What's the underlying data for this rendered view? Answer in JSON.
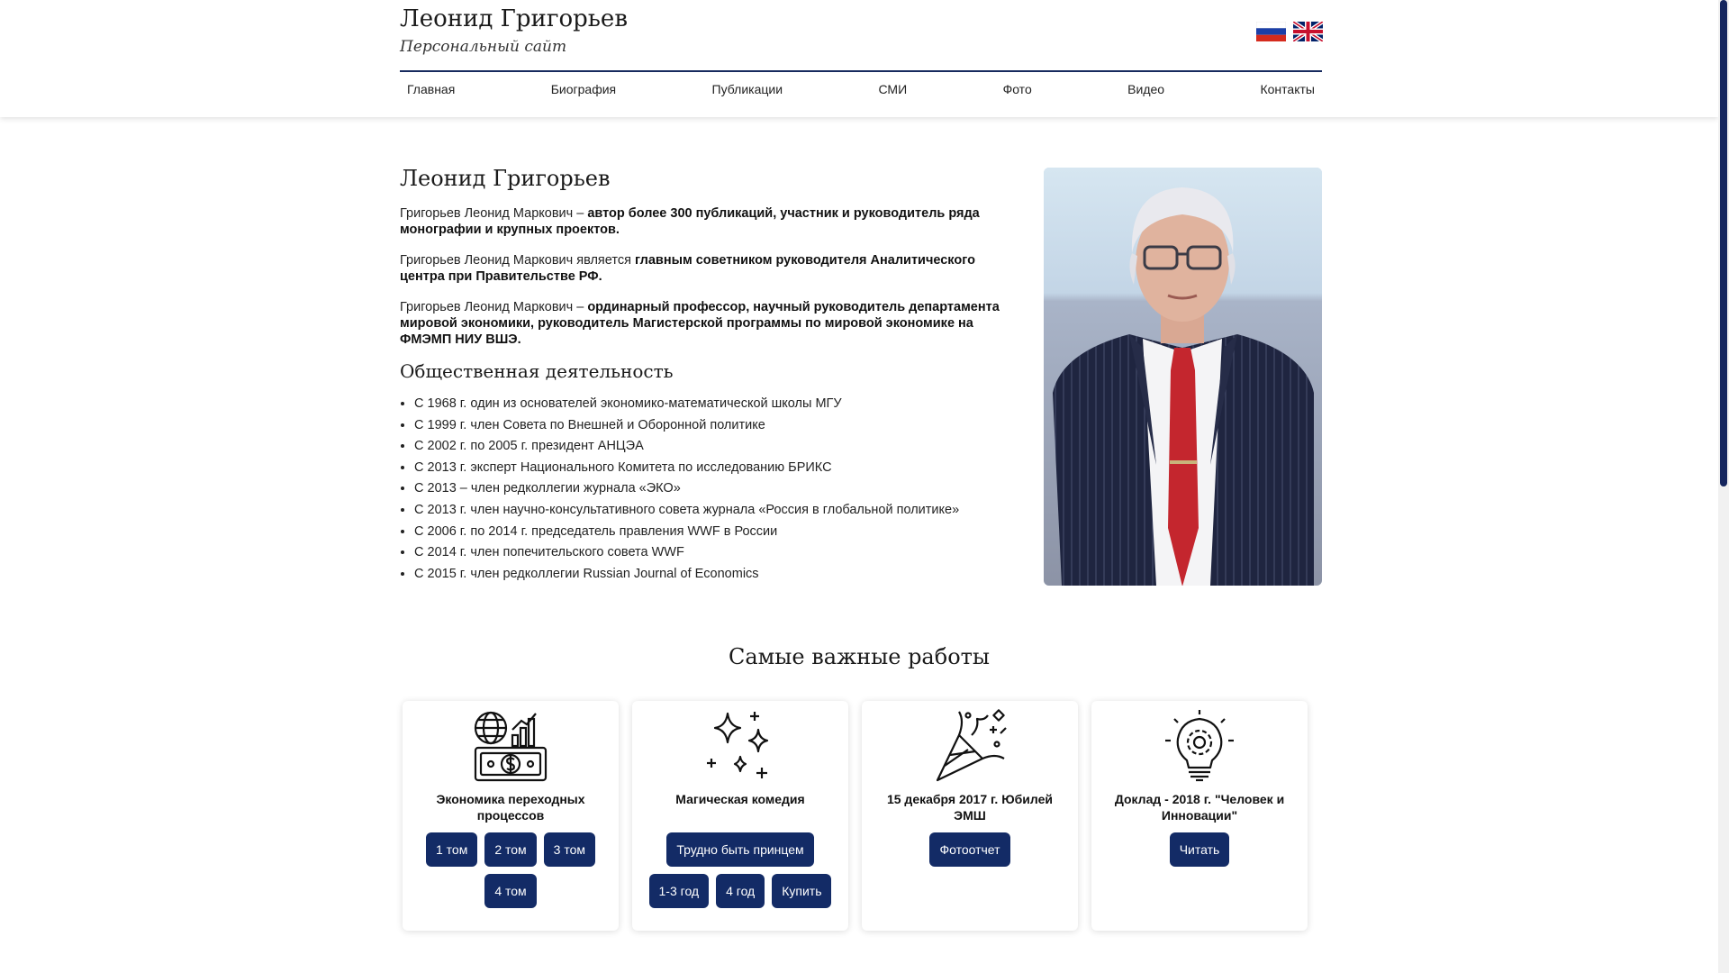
{
  "header": {
    "site_name": "Леонид Григорьев",
    "site_subtitle": "Персональный сайт",
    "nav": [
      "Главная",
      "Биография",
      "Публикации",
      "СМИ",
      "Фото",
      "Видео",
      "Контакты"
    ]
  },
  "main": {
    "title": "Леонид Григорьев",
    "bio": [
      {
        "plain": "Григорьев Леонид Маркович – ",
        "bold": "автор более 300 публикаций, участник и руководитель ряда монографии и крупных проектов."
      },
      {
        "plain": "Григорьев Леонид Маркович является ",
        "bold": "главным советником руководителя Аналитического центра при Правительстве РФ."
      },
      {
        "plain": "Григорьев Леонид Маркович – ",
        "bold": "ординарный профессор, научный руководитель департамента мировой экономики, руководитель Магистерской программы по мировой экономике на ФМЭМП НИУ ВШЭ."
      }
    ],
    "activity_title": "Общественная деятельность",
    "activity": [
      "С 1968 г. один из основателей экономико-математической школы МГУ",
      "С 1999 г. член Совета по Внешней и Оборонной политике",
      "С 2002 г. по 2005 г. президент АНЦЭА",
      "С 2013 г. эксперт Национального Комитета по исследованию БРИКС",
      "С 2013 – член редколлегии журнала «ЭКО»",
      "С 2013 г. член научно-консультативного совета журнала «Россия в глобальной политике»",
      "С 2006 г. по 2014 г. председатель правления WWF в России",
      "С 2014 г. член попечительского совета WWF",
      "С 2015 г. член редколлегии Russian Journal of Economics"
    ]
  },
  "works": {
    "title": "Самые важные работы",
    "cards": [
      {
        "icon": "globe-money-icon",
        "title": "Экономика переходных процессов",
        "buttons": [
          "1 том",
          "2 том",
          "3 том",
          "4 том"
        ]
      },
      {
        "icon": "sparkles-icon",
        "title": "Магическая комедия",
        "buttons": [
          "Трудно быть принцем",
          "1-3 год",
          "4 год",
          "Купить"
        ]
      },
      {
        "icon": "party-popper-icon",
        "title": "15 декабря 2017 г. Юбилей ЭМШ",
        "buttons": [
          "Фотоотчет"
        ]
      },
      {
        "icon": "lightbulb-gear-icon",
        "title": "Доклад - 2018 г. \"Человек и Инновации\"",
        "buttons": [
          "Читать"
        ]
      }
    ]
  },
  "colors": {
    "accent": "#132b66",
    "text": "#222222"
  }
}
